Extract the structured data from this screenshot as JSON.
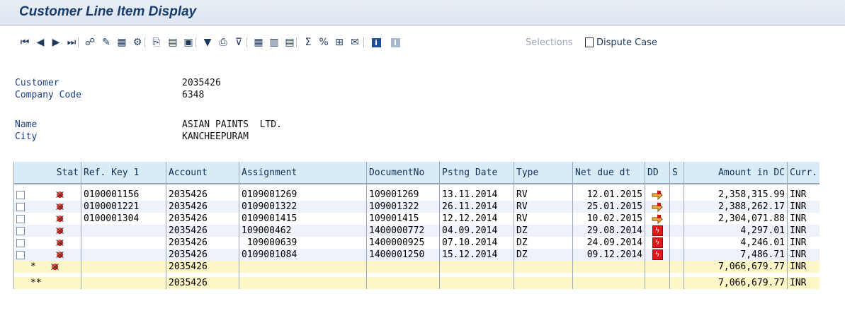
{
  "window": {
    "title": "Customer Line Item Display"
  },
  "toolbar": {
    "items": [
      {
        "icon": "first-icon",
        "glyph": "⏮"
      },
      {
        "icon": "previous-icon",
        "glyph": "◀"
      },
      {
        "icon": "next-icon",
        "glyph": "▶"
      },
      {
        "icon": "last-icon",
        "glyph": "⏭"
      },
      {
        "icon": "select-icon",
        "glyph": "☍"
      },
      {
        "icon": "edit-icon",
        "glyph": "✎"
      },
      {
        "icon": "layout-icon",
        "glyph": "▦"
      },
      {
        "icon": "settings-icon",
        "glyph": "⚙"
      },
      {
        "icon": "display-doc-icon",
        "glyph": "⎘"
      },
      {
        "icon": "document-icon",
        "glyph": "▤"
      },
      {
        "icon": "notes-icon",
        "glyph": "▣"
      },
      {
        "icon": "filter-icon",
        "glyph": "▼"
      },
      {
        "icon": "print-icon",
        "glyph": "⎙"
      },
      {
        "icon": "filter-set-icon",
        "glyph": "⊽"
      },
      {
        "icon": "grid-icon",
        "glyph": "▦"
      },
      {
        "icon": "columns-icon",
        "glyph": "▥"
      },
      {
        "icon": "rows-icon",
        "glyph": "▤"
      },
      {
        "icon": "sum-icon",
        "glyph": "Σ"
      },
      {
        "icon": "percent-icon",
        "glyph": "%"
      },
      {
        "icon": "export-icon",
        "glyph": "⊞"
      },
      {
        "icon": "mail-icon",
        "glyph": "✉"
      },
      {
        "icon": "info-icon",
        "glyph": "i"
      },
      {
        "icon": "selections-info-icon",
        "glyph": "i"
      }
    ],
    "selections_label": "Selections",
    "dispute_case_label": "Dispute Case"
  },
  "header": {
    "customer_label": "Customer",
    "customer_value": "2035426",
    "company_code_label": "Company Code",
    "company_code_value": "6348",
    "name_label": "Name",
    "name_value": "ASIAN PAINTS  LTD.",
    "city_label": "City",
    "city_value": "KANCHEEPURAM"
  },
  "table": {
    "columns": [
      "Stat",
      "Ref. Key 1",
      "Account",
      "Assignment",
      "DocumentNo",
      "Pstng Date",
      "Type",
      "Net due dt",
      "DD",
      "S",
      "Amount in DC",
      "Curr."
    ],
    "rows": [
      {
        "ref": "0100001156",
        "account": "2035426",
        "assignment": "0109001269",
        "docno": "109001269",
        "pdate": "13.11.2014",
        "type": "RV",
        "netdue": "12.01.2015",
        "dd": "due-arrow-icon",
        "amount": "2,358,315.99",
        "curr": "INR"
      },
      {
        "ref": "0100001221",
        "account": "2035426",
        "assignment": "0109001322",
        "docno": "109001322",
        "pdate": "26.11.2014",
        "type": "RV",
        "netdue": "25.01.2015",
        "dd": "due-arrow-icon",
        "amount": "2,388,262.17",
        "curr": "INR"
      },
      {
        "ref": "0100001304",
        "account": "2035426",
        "assignment": "0109001415",
        "docno": "109001415",
        "pdate": "12.12.2014",
        "type": "RV",
        "netdue": "10.02.2015",
        "dd": "due-arrow-icon",
        "amount": "2,304,071.88",
        "curr": "INR"
      },
      {
        "ref": "",
        "account": "2035426",
        "assignment": "109000462",
        "docno": "1400000772",
        "pdate": "04.09.2014",
        "type": "DZ",
        "netdue": "29.08.2014",
        "dd": "overdue-icon",
        "amount": "4,297.01",
        "curr": "INR"
      },
      {
        "ref": "",
        "account": "2035426",
        "assignment": " 109000639",
        "docno": "1400000925",
        "pdate": "07.10.2014",
        "type": "DZ",
        "netdue": "24.09.2014",
        "dd": "overdue-icon",
        "amount": "4,246.01",
        "curr": "INR"
      },
      {
        "ref": "",
        "account": "2035426",
        "assignment": "0109001084",
        "docno": "1400001250",
        "pdate": "15.12.2014",
        "type": "DZ",
        "netdue": "09.12.2014",
        "dd": "overdue-icon",
        "amount": "7,486.71",
        "curr": "INR"
      }
    ],
    "subtotal": {
      "marker": "*",
      "account": "2035426",
      "amount": "7,066,679.77",
      "curr": "INR"
    },
    "total": {
      "marker": "**",
      "account": "2035426",
      "amount": "7,066,679.77",
      "curr": "INR"
    }
  },
  "colors": {
    "title": "#163c6d",
    "header_bg": "#d7ecf7",
    "sum_bg": "#fdf6c6",
    "status_red": "#d0140c"
  }
}
